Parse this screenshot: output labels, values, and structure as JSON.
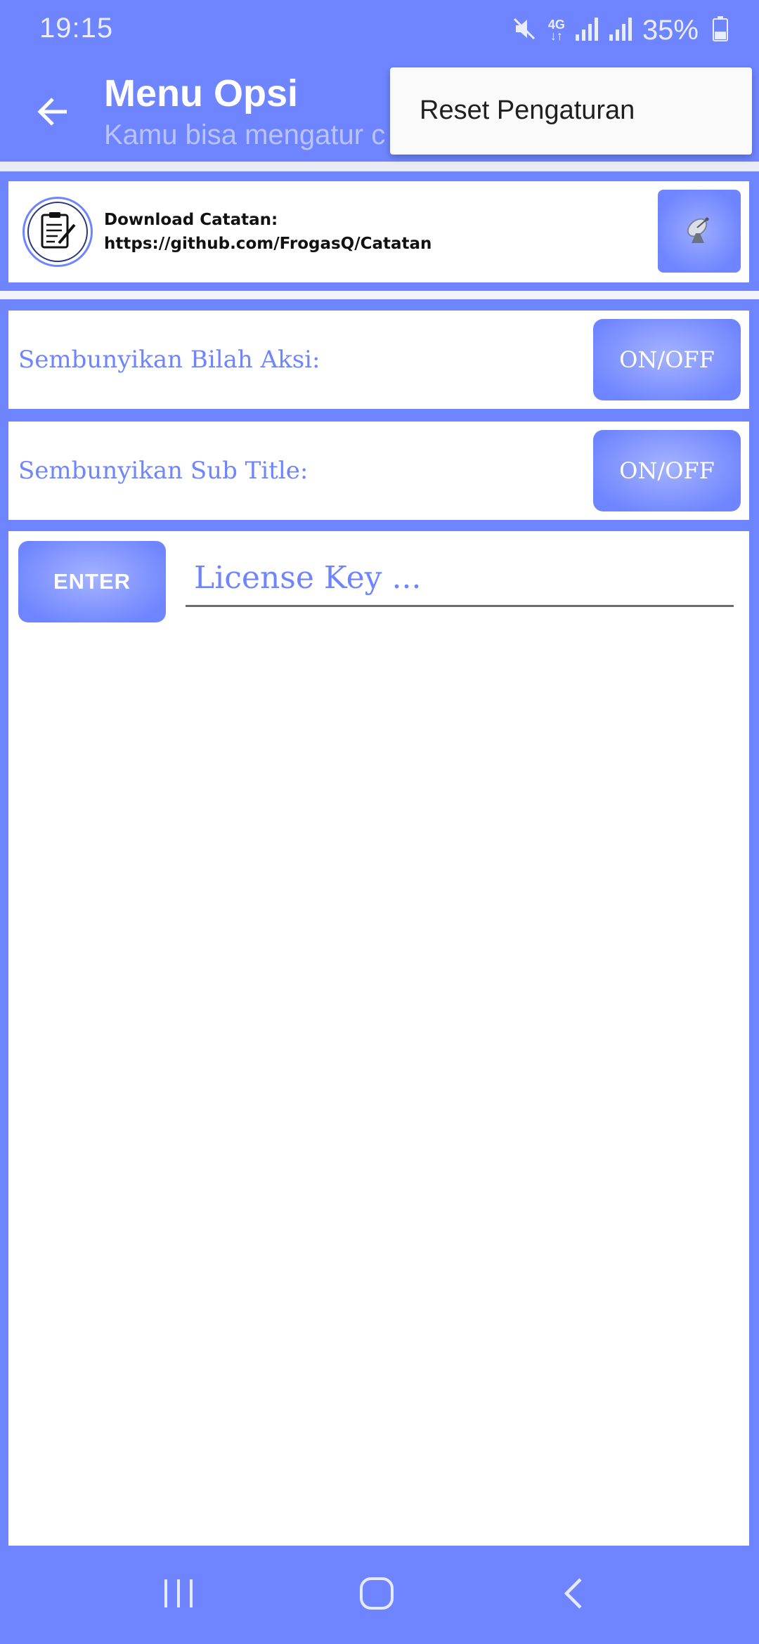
{
  "status_bar": {
    "time": "19:15",
    "network": "4G",
    "battery": "35%",
    "icons": [
      "mute-icon",
      "network-4g-icon",
      "signal-icon",
      "signal-icon",
      "battery-icon"
    ]
  },
  "action_bar": {
    "title": "Menu Opsi",
    "subtitle": "Kamu bisa mengatur c",
    "back_icon": "arrow-left-icon"
  },
  "popup_menu": {
    "items": [
      {
        "label": "Reset Pengaturan"
      }
    ]
  },
  "download_card": {
    "line1": "Download Catatan:",
    "line2": "https://github.com/FrogasQ/Catatan",
    "logo_icon": "clipboard-pen-icon",
    "button_icon": "satellite-dish-icon"
  },
  "settings": [
    {
      "label": "Sembunyikan Bilah Aksi:",
      "button": "ON/OFF"
    },
    {
      "label": "Sembunyikan Sub Title:",
      "button": "ON/OFF"
    }
  ],
  "license": {
    "enter_label": "ENTER",
    "placeholder": "License Key ..."
  },
  "nav_bar": {
    "icons": [
      "recents-icon",
      "home-icon",
      "back-icon"
    ]
  },
  "colors": {
    "accent": "#6f85ff",
    "accent_light": "#a5b3ff",
    "subtitle": "#b8c3ff",
    "card_bg": "#ffffff",
    "popup_bg": "#fafafa"
  }
}
